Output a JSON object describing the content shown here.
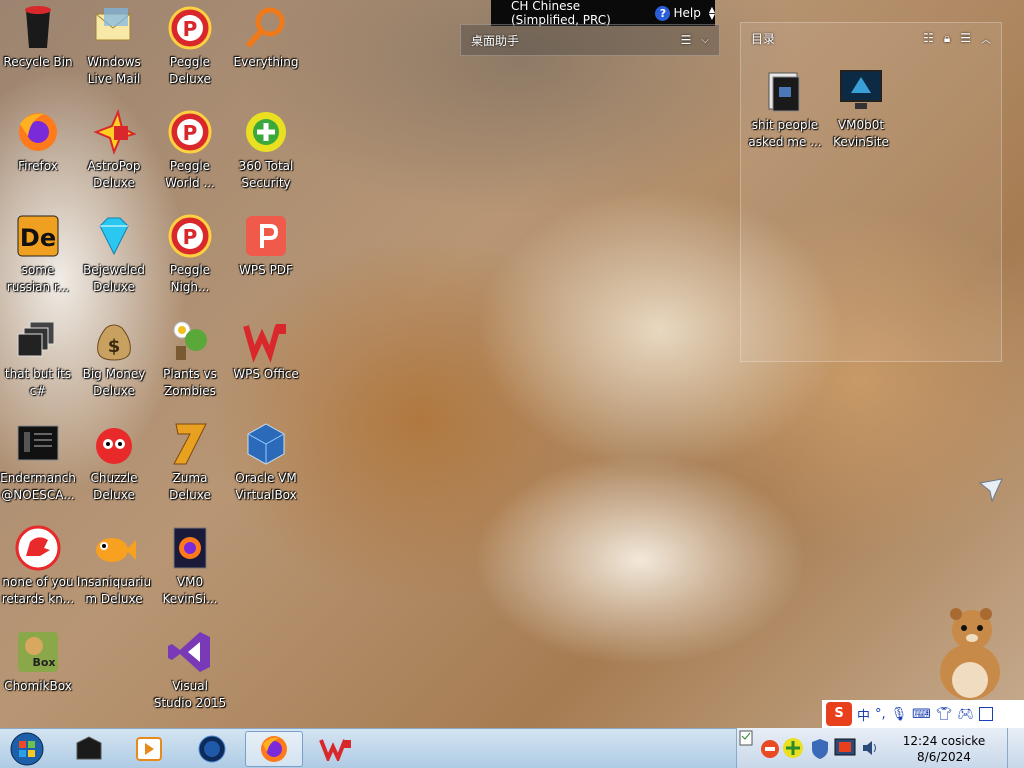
{
  "desktop_icons": [
    {
      "label": "Recycle Bin",
      "icon": "recycle-bin-icon"
    },
    {
      "label": "Windows Live Mail",
      "icon": "mail-icon"
    },
    {
      "label": "Peggle Deluxe",
      "icon": "peggle-icon"
    },
    {
      "label": "Everything",
      "icon": "magnifier-icon"
    },
    {
      "label": "Firefox",
      "icon": "firefox-icon"
    },
    {
      "label": "AstroPop Deluxe",
      "icon": "astropop-icon"
    },
    {
      "label": "Peggle World ...",
      "icon": "peggle-icon"
    },
    {
      "label": "360 Total Security",
      "icon": "security-plus-icon"
    },
    {
      "label": "some russian r...",
      "icon": "de-app-icon"
    },
    {
      "label": "Bejeweled Deluxe",
      "icon": "gem-icon"
    },
    {
      "label": "Peggle Nigh...",
      "icon": "peggle-icon"
    },
    {
      "label": "WPS PDF",
      "icon": "wps-pdf-icon"
    },
    {
      "label": "that but its c#",
      "icon": "windows-stack-icon"
    },
    {
      "label": "Big Money Deluxe",
      "icon": "money-bag-icon"
    },
    {
      "label": "Plants vs Zombies",
      "icon": "plant-icon"
    },
    {
      "label": "WPS Office",
      "icon": "wps-office-icon"
    },
    {
      "label": "Endermanch @NOESCA...",
      "icon": "terminal-icon"
    },
    {
      "label": "Chuzzle Deluxe",
      "icon": "chuzzle-icon"
    },
    {
      "label": "Zuma Deluxe",
      "icon": "zuma-icon"
    },
    {
      "label": "Oracle VM VirtualBox",
      "icon": "virtualbox-icon"
    },
    {
      "label": "none of you retards kn...",
      "icon": "dino-icon"
    },
    {
      "label": "Insaniquarium Deluxe",
      "icon": "goldfish-icon"
    },
    {
      "label": "VM0 KevinSi...",
      "icon": "firefox-file-icon"
    },
    {
      "label": "ChomikBox",
      "icon": "hamster-box-icon"
    },
    {
      "label": "Visual Studio 2015",
      "icon": "visual-studio-icon"
    }
  ],
  "topbar": {
    "language": "CH Chinese (Simplified, PRC)",
    "help": "Help"
  },
  "fence_left": {
    "title": "桌面助手"
  },
  "fence_right": {
    "title": "目录",
    "items": [
      {
        "label": "shit people asked me ...",
        "icon": "folder-icon"
      },
      {
        "label": "VM0b0t KevinSite",
        "icon": "monitor-icon"
      }
    ]
  },
  "ime": {
    "logo": "S",
    "mode": "中",
    "punct": "°,"
  },
  "clock": {
    "time": "12:24 cosicke",
    "date": "8/6/2024"
  },
  "colors": {
    "taskbar": "#b8d0e8",
    "ime_red": "#e8401c",
    "wps_red": "#d8282c"
  }
}
